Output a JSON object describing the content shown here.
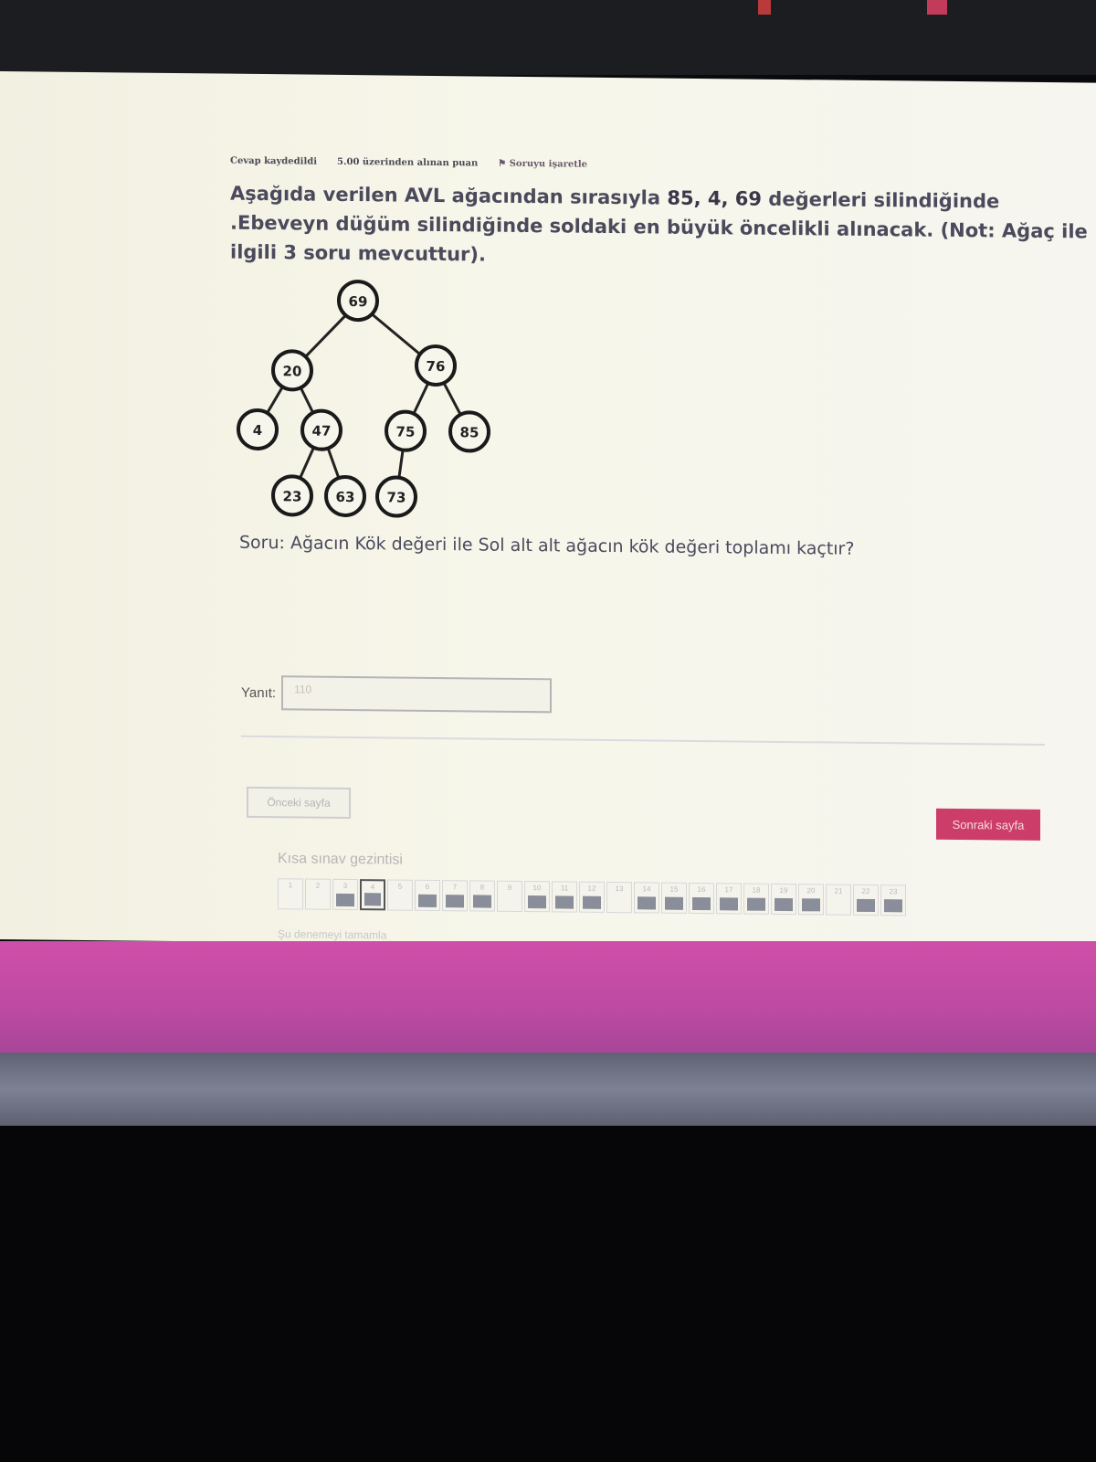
{
  "header": {
    "status": "Cevap kaydedildi",
    "points": "5.00 üzerinden alınan puan",
    "flag": "Soruyu işaretle"
  },
  "question": {
    "prompt_start": "Aşağıda verilen AVL ağacından sırasıyla ",
    "prompt_values": "85, 4, 69",
    "prompt_end": " değerleri silindiğinde .Ebeveyn düğüm silindiğinde soldaki en büyük öncelikli alınacak. (Not: Ağaç ile ilgili 3 soru mevcuttur).",
    "question_text": "Soru: Ağacın Kök değeri ile Sol alt alt ağacın kök değeri toplamı kaçtır?"
  },
  "tree": {
    "nodes": [
      "69",
      "20",
      "76",
      "4",
      "47",
      "75",
      "85",
      "23",
      "63",
      "73"
    ]
  },
  "answer": {
    "label": "Yanıt:",
    "value": "110"
  },
  "nav": {
    "prev_label": "Önceki sayfa",
    "next_label": "Sonraki sayfa",
    "quiz_nav_title": "Kısa sınav gezintisi",
    "finish_label": "Şu denemeyi tamamla",
    "cells": [
      {
        "num": "1",
        "answered": false,
        "current": false
      },
      {
        "num": "2",
        "answered": false,
        "current": false
      },
      {
        "num": "3",
        "answered": true,
        "current": false
      },
      {
        "num": "4",
        "answered": true,
        "current": true
      },
      {
        "num": "5",
        "answered": false,
        "current": false
      },
      {
        "num": "6",
        "answered": true,
        "current": false
      },
      {
        "num": "7",
        "answered": true,
        "current": false
      },
      {
        "num": "8",
        "answered": true,
        "current": false
      },
      {
        "num": "9",
        "answered": false,
        "current": false
      },
      {
        "num": "10",
        "answered": true,
        "current": false
      },
      {
        "num": "11",
        "answered": true,
        "current": false
      },
      {
        "num": "12",
        "answered": true,
        "current": false
      },
      {
        "num": "13",
        "answered": false,
        "current": false
      },
      {
        "num": "14",
        "answered": true,
        "current": false
      },
      {
        "num": "15",
        "answered": true,
        "current": false
      },
      {
        "num": "16",
        "answered": true,
        "current": false
      },
      {
        "num": "17",
        "answered": true,
        "current": false
      },
      {
        "num": "18",
        "answered": true,
        "current": false
      },
      {
        "num": "19",
        "answered": true,
        "current": false
      },
      {
        "num": "20",
        "answered": true,
        "current": false
      },
      {
        "num": "21",
        "answered": false,
        "current": false
      },
      {
        "num": "22",
        "answered": true,
        "current": false
      },
      {
        "num": "23",
        "answered": true,
        "current": false
      }
    ]
  },
  "colors": {
    "accent_button": "#cc3d6a",
    "pink_band": "#c64ca6"
  }
}
